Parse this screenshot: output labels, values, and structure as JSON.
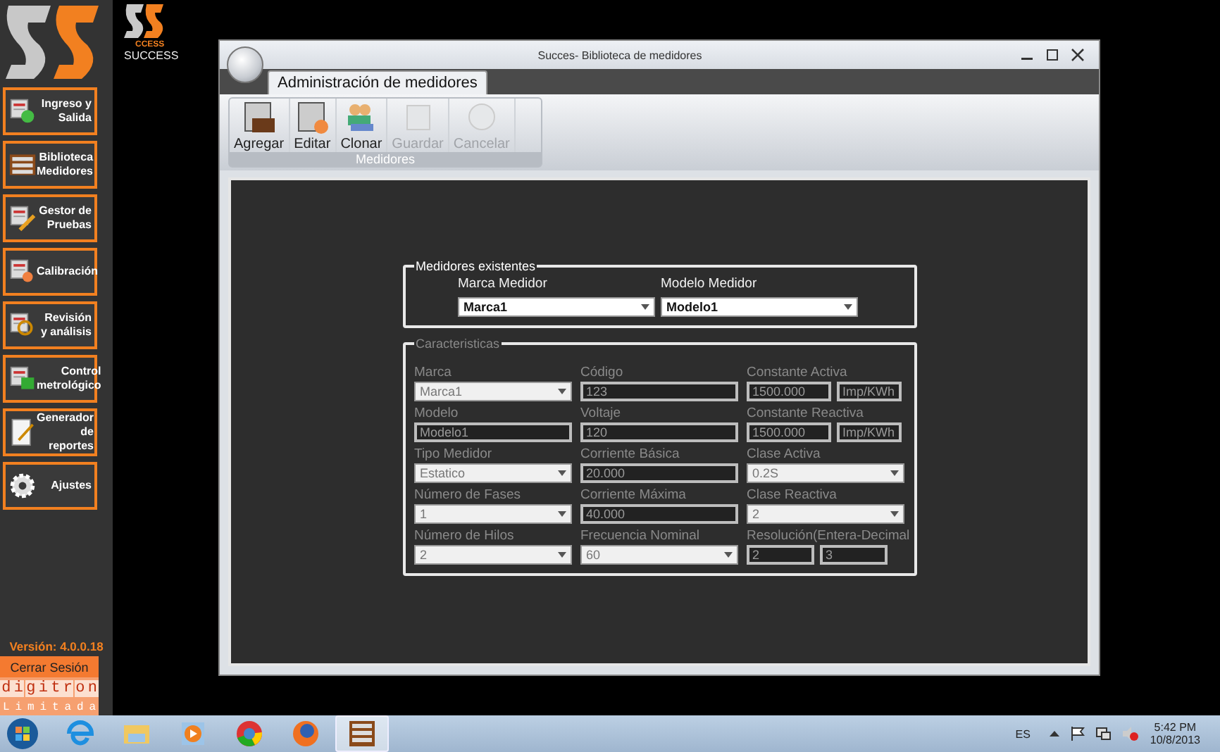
{
  "sidebar": {
    "logo_label": "SUCCESS",
    "logo_mark_text": "CCESS",
    "items": [
      {
        "label": "Ingreso y Salida",
        "kind": "inout"
      },
      {
        "label": "Biblioteca Medidores",
        "kind": "library"
      },
      {
        "label": "Gestor de Pruebas",
        "kind": "tests"
      },
      {
        "label": "Calibración",
        "kind": "calibration"
      },
      {
        "label": "Revisión y análisis",
        "kind": "review"
      },
      {
        "label": "Control metrológico",
        "kind": "control"
      },
      {
        "label": "Generador de reportes",
        "kind": "report"
      },
      {
        "label": "Ajustes",
        "kind": "settings"
      }
    ],
    "version": "Versión: 4.0.0.18",
    "logout": "Cerrar Sesión",
    "company_letters": [
      "d",
      "i",
      "g",
      "i",
      "t",
      "r",
      "o",
      "n"
    ],
    "company_sub": [
      "L",
      "i",
      "m",
      "i",
      "t",
      "a",
      "d",
      "a"
    ]
  },
  "window": {
    "title": "Succes- Biblioteca de medidores",
    "tabs": [
      {
        "label": "Administración de medidores",
        "selected": true
      }
    ],
    "ribbon": {
      "group": "Medidores",
      "buttons": [
        {
          "label": "Agregar",
          "kind": "add",
          "disabled": false
        },
        {
          "label": "Editar",
          "kind": "edit",
          "disabled": false
        },
        {
          "label": "Clonar",
          "kind": "clone",
          "disabled": false
        },
        {
          "label": "Guardar",
          "kind": "save",
          "disabled": true
        },
        {
          "label": "Cancelar",
          "kind": "cancel",
          "disabled": true
        }
      ]
    },
    "existing": {
      "title": "Medidores existentes",
      "fields": [
        {
          "label": "Marca Medidor",
          "value": "Marca1"
        },
        {
          "label": "Modelo Medidor",
          "value": "Modelo1"
        }
      ]
    },
    "characteristics": {
      "title": "Caracteristicas",
      "disabled": true,
      "fields": [
        {
          "label": "Marca",
          "inputs": [
            {
              "kind": "select",
              "value": "Marca1"
            }
          ]
        },
        {
          "label": "Código",
          "inputs": [
            {
              "kind": "text",
              "value": "123"
            }
          ]
        },
        {
          "label": "Constante Activa",
          "inputs": [
            {
              "kind": "text",
              "value": "1500.000"
            },
            {
              "kind": "unit",
              "value": "Imp/KWh"
            }
          ]
        },
        {
          "label": "Modelo",
          "inputs": [
            {
              "kind": "text",
              "value": "Modelo1"
            }
          ]
        },
        {
          "label": "Voltaje",
          "inputs": [
            {
              "kind": "text",
              "value": "120"
            }
          ]
        },
        {
          "label": "Constante Reactiva",
          "inputs": [
            {
              "kind": "text",
              "value": "1500.000"
            },
            {
              "kind": "unit",
              "value": "Imp/KWh"
            }
          ]
        },
        {
          "label": "Tipo Medidor",
          "inputs": [
            {
              "kind": "select",
              "value": "Estatico"
            }
          ]
        },
        {
          "label": "Corriente Básica",
          "inputs": [
            {
              "kind": "text",
              "value": "20.000"
            }
          ]
        },
        {
          "label": "Clase Activa",
          "inputs": [
            {
              "kind": "select",
              "value": "0.2S"
            }
          ]
        },
        {
          "label": "Número de Fases",
          "inputs": [
            {
              "kind": "select",
              "value": "1"
            }
          ]
        },
        {
          "label": "Corriente Máxima",
          "inputs": [
            {
              "kind": "text",
              "value": "40.000"
            }
          ]
        },
        {
          "label": "Clase Reactiva",
          "inputs": [
            {
              "kind": "select",
              "value": "2"
            }
          ]
        },
        {
          "label": "Número de Hilos",
          "inputs": [
            {
              "kind": "select",
              "value": "2"
            }
          ]
        },
        {
          "label": "Frecuencia Nominal",
          "inputs": [
            {
              "kind": "select",
              "value": "60"
            }
          ]
        },
        {
          "label": "Resolución(Entera-Decimal",
          "inputs": [
            {
              "kind": "half",
              "value": "2"
            },
            {
              "kind": "half",
              "value": "3"
            }
          ]
        }
      ]
    }
  },
  "taskbar": {
    "apps": [
      {
        "kind": "ie",
        "selected": false
      },
      {
        "kind": "folder",
        "selected": false
      },
      {
        "kind": "media",
        "selected": false
      },
      {
        "kind": "chrome",
        "selected": false
      },
      {
        "kind": "firefox",
        "selected": false
      },
      {
        "kind": "library",
        "selected": true
      }
    ],
    "language": "ES",
    "time": "5:42 PM",
    "date": "10/8/2013"
  }
}
